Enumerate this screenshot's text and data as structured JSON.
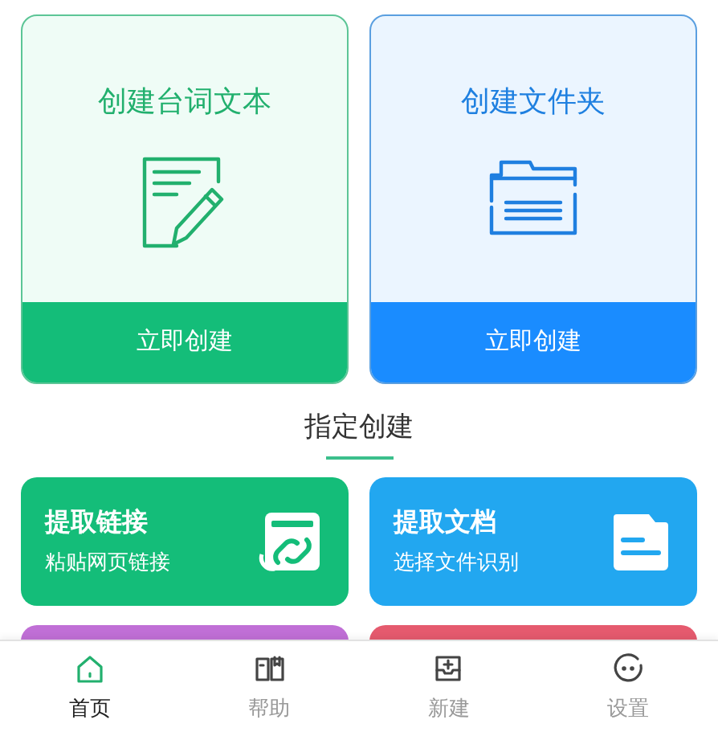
{
  "create_cards": [
    {
      "kind": "text",
      "title": "创建台词文本",
      "button": "立即创建"
    },
    {
      "kind": "folder",
      "title": "创建文件夹",
      "button": "立即创建"
    }
  ],
  "section_title": "指定创建",
  "quick_cards": [
    {
      "kind": "link",
      "title": "提取链接",
      "subtitle": "粘贴网页链接",
      "color": "#14bd79"
    },
    {
      "kind": "document",
      "title": "提取文档",
      "subtitle": "选择文件识别",
      "color": "#22a7f0"
    },
    {
      "kind": "partial",
      "color": "#c06fd6"
    },
    {
      "kind": "partial",
      "color": "#e55a6e"
    }
  ],
  "tab_bar": [
    {
      "kind": "home",
      "label": "首页",
      "selected": true
    },
    {
      "kind": "help",
      "label": "帮助",
      "selected": false
    },
    {
      "kind": "new",
      "label": "新建",
      "selected": false
    },
    {
      "kind": "settings",
      "label": "设置",
      "selected": false
    }
  ]
}
